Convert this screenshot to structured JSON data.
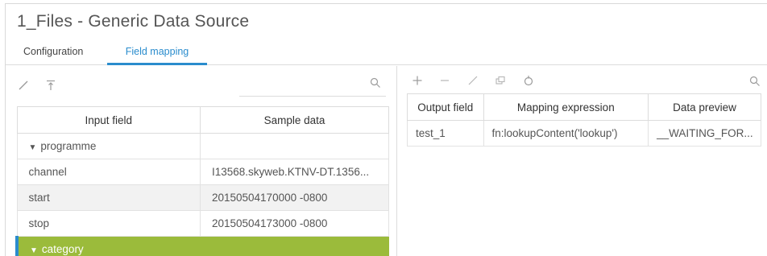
{
  "window": {
    "title": "1_Files - Generic Data Source"
  },
  "tabs": [
    {
      "label": "Configuration"
    },
    {
      "label": "Field mapping"
    }
  ],
  "left_panel": {
    "toolbar": {
      "icons": [
        "pencil-icon",
        "align-top-icon"
      ]
    },
    "search": {
      "icon": "search-icon"
    },
    "columns": [
      "Input field",
      "Sample data"
    ],
    "rows": [
      {
        "field": "programme",
        "sample": "",
        "expand_glyph": "▼"
      },
      {
        "field": "channel",
        "sample": "I13568.skyweb.KTNV-DT.1356..."
      },
      {
        "field": "start",
        "sample": "20150504170000 -0800"
      },
      {
        "field": "stop",
        "sample": "20150504173000 -0800"
      },
      {
        "field": "category",
        "sample": "",
        "expand_glyph": "▼"
      }
    ]
  },
  "right_panel": {
    "toolbar": {
      "icons": [
        "add-icon",
        "remove-icon",
        "edit-icon",
        "copy-icon",
        "refresh-icon"
      ]
    },
    "search": {
      "icon": "search-icon"
    },
    "columns": [
      "Output field",
      "Mapping expression",
      "Data preview"
    ],
    "rows": [
      {
        "output": "test_1",
        "expression": "fn:lookupContent('lookup')",
        "preview": "__WAITING_FOR..."
      }
    ]
  },
  "colors": {
    "accent": "#2a8ccd",
    "selected_row": "#9bbb3b",
    "alt_row": "#f2f2f2"
  }
}
